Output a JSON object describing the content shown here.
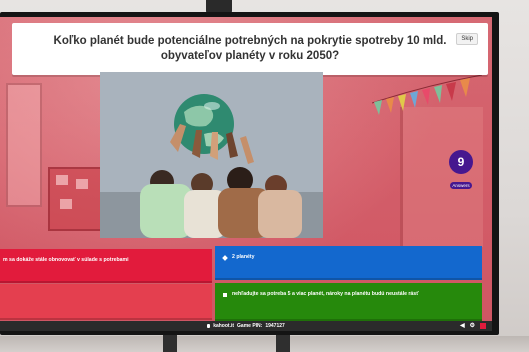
{
  "question": {
    "text": "Koľko planét bude potenciálne potrebných na pokrytie spotreby 10 mld. obyvateľov planéty v roku 2050?",
    "skip_label": "Skip"
  },
  "answers_counter": {
    "count": "9",
    "label": "Answers"
  },
  "answers": [
    {
      "shape": "triangle",
      "color": "#e21b3c",
      "text": "m sa dokáže stále obnovovať v súlade s potrebami"
    },
    {
      "shape": "diamond",
      "color": "#1368ce",
      "text": "2 planéty"
    },
    {
      "shape": "circle",
      "color": "#e43f4f",
      "text": ""
    },
    {
      "shape": "square",
      "color": "#26890c",
      "text": "nehľadujte sa potreba 5 a viac planét, nároky na planétu budú neustále rásť"
    }
  ],
  "bottom_bar": {
    "site": "kahoot.it",
    "game_pin_label": "Game PIN:",
    "game_pin": "1947127"
  },
  "icons": {
    "sound": "speaker-icon",
    "settings": "gear-icon",
    "fullscreen": "fullscreen-icon"
  },
  "colors": {
    "red": "#e21b3c",
    "blue": "#1368ce",
    "green": "#26890c",
    "purple": "#46178f"
  }
}
